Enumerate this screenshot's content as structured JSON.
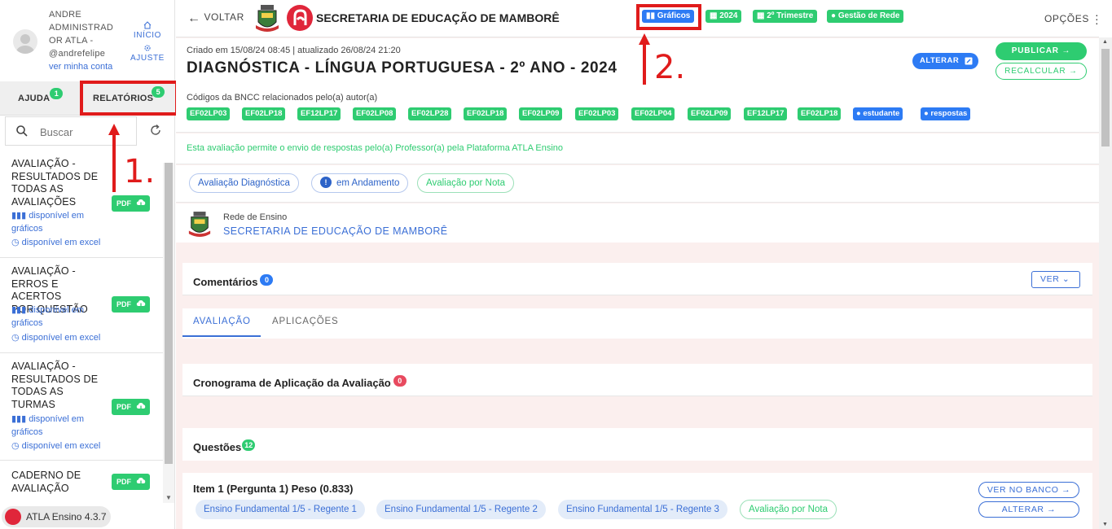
{
  "user": {
    "name": "ANDRE ADMINISTRADOR ATLA - @andrefelipe",
    "name_lines": [
      "ANDRE",
      "ADMINISTRAD",
      "OR ATLA -",
      "@andrefelipe"
    ],
    "account_link": "ver minha conta",
    "home_label": "INÍCIO",
    "settings_label": "AJUSTE"
  },
  "sidebar": {
    "tabs": [
      {
        "label": "AJUDA",
        "count": "1"
      },
      {
        "label": "RELATÓRIOS",
        "count": "5"
      }
    ],
    "search_placeholder": "Buscar",
    "reports": [
      {
        "title": "AVALIAÇÃO - RESULTADOS DE TODAS AS AVALIAÇÕES",
        "title_lines": [
          "AVALIAÇÃO -",
          "RESULTADOS DE",
          "TODAS AS",
          "AVALIAÇÕES"
        ],
        "pdf": "PDF",
        "charts": "disponível em gráficos",
        "charts_lines": [
          "disponível em",
          "gráficos"
        ],
        "excel": "disponível em excel"
      },
      {
        "title": "AVALIAÇÃO - ERROS E ACERTOS POR QUESTÃO",
        "title_lines": [
          "AVALIAÇÃO -",
          "ERROS E ACERTOS",
          "POR QUESTÃO"
        ],
        "pdf": "PDF",
        "charts": "disponível em gráficos",
        "charts_lines": [
          "disponível em",
          "gráficos"
        ],
        "excel": "disponível em excel"
      },
      {
        "title": "AVALIAÇÃO - RESULTADOS DE TODAS AS TURMAS",
        "title_lines": [
          "AVALIAÇÃO -",
          "RESULTADOS DE",
          "TODAS AS",
          "TURMAS"
        ],
        "pdf": "PDF",
        "charts": "disponível em gráficos",
        "charts_lines": [
          "disponível em",
          "gráficos"
        ],
        "excel": "disponível em excel"
      },
      {
        "title": "CADERNO DE AVALIAÇÃO",
        "title_lines": [
          "CADERNO DE",
          "AVALIAÇÃO"
        ],
        "pdf": "PDF"
      }
    ],
    "version": "ATLA Ensino 4.3.7"
  },
  "topbar": {
    "back_label": "VOLTAR",
    "org_title": "SECRETARIA DE EDUCAÇÃO DE MAMBORÊ",
    "chips": [
      "Gráficos",
      "2024",
      "2º Trimestre",
      "Gestão de Rede"
    ],
    "options_label": "OPÇÕES"
  },
  "header": {
    "created": "Criado em 15/08/24 08:45 | atualizado 26/08/24 21:20",
    "title": "DIAGNÓSTICA - LÍNGUA PORTUGUESA - 2º ANO - 2024",
    "alterar": "ALTERAR",
    "publicar": "PUBLICAR",
    "recalcular": "RECALCULAR",
    "bncc_label": "Códigos da BNCC relacionados pelo(a) autor(a)",
    "codes": [
      "EF02LP03",
      "EF02LP18",
      "EF12LP17",
      "EF02LP08",
      "EF02LP28",
      "EF02LP18",
      "EF02LP09",
      "EF02LP03",
      "EF02LP04",
      "EF02LP09",
      "EF12LP17",
      "EF02LP18"
    ],
    "tags": [
      "estudante",
      "respostas"
    ]
  },
  "info_text": "Esta avaliação permite o envio de respostas pelo(a) Professor(a) pela Plataforma ATLA Ensino",
  "pills": [
    "Avaliação Diagnóstica",
    "em Andamento",
    "Avaliação por Nota"
  ],
  "rede": {
    "label": "Rede de Ensino",
    "name": "SECRETARIA DE EDUCAÇÃO DE MAMBORÊ"
  },
  "comentarios": {
    "title": "Comentários",
    "count": "0",
    "ver": "VER"
  },
  "subtabs": [
    "AVALIAÇÃO",
    "APLICAÇÕES"
  ],
  "cronograma": {
    "title": "Cronograma de Aplicação da Avaliação",
    "count": "0"
  },
  "questoes": {
    "title": "Questões",
    "count": "12"
  },
  "item": {
    "title": "Item 1 (Pergunta 1) Peso (0.833)",
    "pills": [
      "Ensino Fundamental 1/5 - Regente 1",
      "Ensino Fundamental 1/5 - Regente 2",
      "Ensino Fundamental 1/5 - Regente 3",
      "Avaliação por Nota"
    ],
    "ver_no_banco": "VER NO BANCO",
    "alterar": "ALTERAR"
  },
  "annotations": [
    "1.",
    "2."
  ],
  "colors": {
    "green": "#2ecc71",
    "blue": "#2d7bf4",
    "red_annotation": "#e01b1b",
    "logo_red": "#e0263a"
  }
}
